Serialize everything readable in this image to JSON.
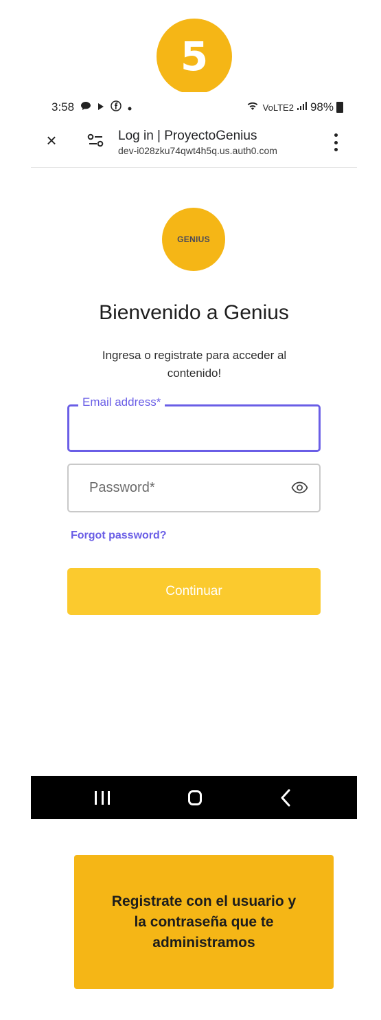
{
  "step": {
    "number": "5"
  },
  "status_bar": {
    "time": "3:58",
    "notification_icons": [
      "chat-bubble-icon",
      "play-icon",
      "facebook-icon",
      "dot-icon"
    ],
    "network_label": "VoLTE2",
    "battery": "98%"
  },
  "browser": {
    "page_title": "Log in | ProyectoGenius",
    "url_host": "dev-i028zku74qwt4h5q.us.auth0.com",
    "close_icon": "×"
  },
  "login": {
    "logo_text": "GENIUS",
    "heading": "Bienvenido a Genius",
    "subtitle": "Ingresa o registrate para acceder al contenido!",
    "email_label": "Email address*",
    "email_value": "",
    "password_placeholder": "Password*",
    "forgot_link": "Forgot password?",
    "continue_label": "Continuar"
  },
  "tip": {
    "text": "Registrate con el usuario y la contraseña que te administramos"
  },
  "colors": {
    "accent_yellow": "#f5b616",
    "button_yellow": "#fbca2e",
    "focus_purple": "#6a5ee6",
    "nav_black": "#000000"
  }
}
